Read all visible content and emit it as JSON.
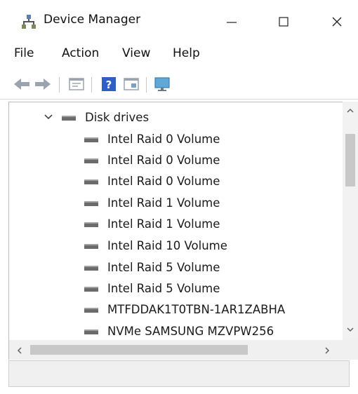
{
  "window": {
    "title": "Device Manager",
    "app_icon": "device-manager-icon"
  },
  "menubar": {
    "items": [
      "File",
      "Action",
      "View",
      "Help"
    ]
  },
  "toolbar": {
    "buttons": [
      "back-arrow-icon",
      "forward-arrow-icon",
      "properties-icon",
      "help-icon",
      "update-driver-icon",
      "monitor-icon"
    ]
  },
  "tree": {
    "category": {
      "label": "Disk drives",
      "expanded": true,
      "icon": "disk-drive-icon"
    },
    "devices": [
      "Intel Raid 0 Volume",
      "Intel Raid 0 Volume",
      "Intel Raid 0 Volume",
      "Intel Raid 1 Volume",
      "Intel Raid 1 Volume",
      "Intel Raid 10 Volume",
      "Intel Raid 5 Volume",
      "Intel Raid 5 Volume",
      "MTFDDAK1T0TBN-1AR1ZABHA",
      "NVMe SAMSUNG MZVPW256"
    ]
  },
  "colors": {
    "scroll_thumb": "#c8c8c8",
    "scroll_track": "#f0f0f0",
    "help_icon_blue": "#2f5fc4"
  }
}
